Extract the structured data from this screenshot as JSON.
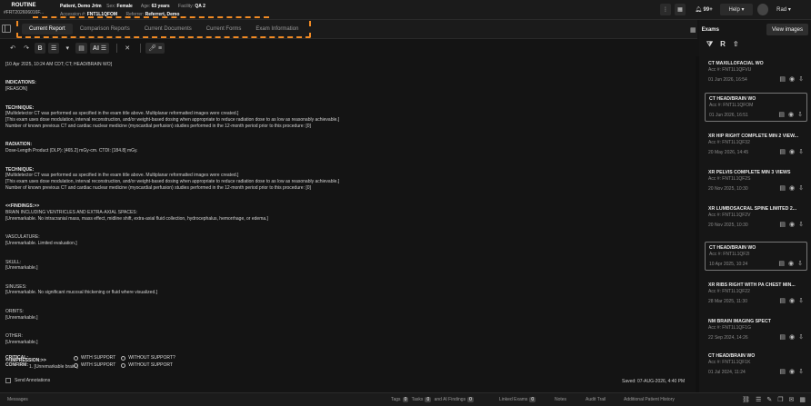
{
  "header": {
    "priority": "ROUTINE",
    "accession_id": "#FRT202606016F...",
    "patient_label": "Patient, Demo Jrtm",
    "sex_label": "Sex:",
    "sex": "Female",
    "age_label": "Age:",
    "age": "63 years",
    "facility_label": "Facility:",
    "facility": "QA 2",
    "accession_label": "Accession #:",
    "accession": "FNT1L1QFOM",
    "referrer_label": "Referrer:",
    "referrer": "Referrert, Demo",
    "notifications": "99+",
    "help": "Help",
    "user": "Rad"
  },
  "tabs": [
    {
      "label": "Current Report"
    },
    {
      "label": "Comparison Reports"
    },
    {
      "label": "Current Documents"
    },
    {
      "label": "Current Forms"
    },
    {
      "label": "Exam Information"
    }
  ],
  "toolbar": {
    "ai_label": "AI"
  },
  "report": {
    "line1": "[10 Apr 2025, 10:24 AM CDT; CT; HEAD/BRAIN WO]",
    "indications_h": "INDICATIONS:",
    "indications": "[REASON]",
    "technique_h": "TECHNIQUE:",
    "technique1": "[Multidetector CT was performed as specified in the exam title above. Multiplanar reformatted images were created.]",
    "technique2": "[This exam uses dose modulation, interval reconstruction, and/or weight-based dosing when appropriate to reduce radiation dose to as low as reasonably achievable.]",
    "technique3": "Number of known previous CT and cardiac nuclear medicine (myocardial perfusion) studies performed in the 12-month period prior to this procedure: [0]",
    "radiation_h": "RADIATION:",
    "radiation": "Dose-Length Product (DLP): [465.2] mGy-cm. CTDI: [184.8] mGy.",
    "technique_h2": "TECHNIQUE:",
    "technique4": "[Multidetector CT was performed as specified in the exam title above. Multiplanar reformatted images were created.]",
    "technique5": "[This exam uses dose modulation, interval reconstruction, and/or weight-based dosing when appropriate to reduce radiation dose to as low as reasonably achievable.]",
    "technique6": "Number of known previous CT and cardiac nuclear medicine (myocardial perfusion) studies performed in the 12-month period prior to this procedure: [0]",
    "findings_h": "<<FINDINGS:>>",
    "brain_h": "BRAIN INCLUDING VENTRICLES AND EXTRA-AXIAL SPACES:",
    "brain": "[Unremarkable. No intracranial mass, mass effect, midline shift, extra-axial fluid collection, hydrocephalus, hemorrhage, or edema.]",
    "vasc_h": "VASCULATURE:",
    "vasc": "[Unremarkable. Limited evaluation.]",
    "skull_h": "SKULL:",
    "skull": "[Unremarkable.]",
    "sinuses_h": "SINUSES:",
    "sinuses": "[Unremarkable. No significant mucosal thickening or fluid where visualized.]",
    "orbits_h": "ORBITS:",
    "orbits": "[Unremarkable.]",
    "other_h": "OTHER:",
    "other": "[Unremarkable.]",
    "impression_h": "<<IMPRESSION:>>",
    "impression": "1. [Unremarkable brain.]"
  },
  "fields": {
    "critical": "CRITICAL:",
    "confirm": "CONFIRM:",
    "with_support": "WITH SUPPORT",
    "without_support": "WITHOUT SUPPORT?",
    "without_support2": "WITHOUT SUPPORT"
  },
  "send_annotations": "Send Annotations",
  "saved": "Saved: 07-AUG-2026, 4:40 PM",
  "status": {
    "messages": "Messages",
    "tags": "Tags",
    "tags_n": "0",
    "tasks": "Tasks",
    "tasks_n": "0",
    "ai": "and AI Findings",
    "ai_n": "0",
    "linked": "Linked Exams",
    "linked_n": "0",
    "notes": "Notes",
    "audit": "Audit Trail",
    "history": "Additional Patient History"
  },
  "exams": {
    "title": "Exams",
    "view_images": "View images",
    "items": [
      {
        "title": "CT MAXILLOFACIAL WO",
        "acc": "Acc #: FNT1L1QFVU",
        "date": "01 Jun 2026, 16:54"
      },
      {
        "title": "CT HEAD/BRAIN WO",
        "acc": "Acc #: FNT1L1QFOM",
        "date": "01 Jun 2026, 16:51"
      },
      {
        "title": "XR HIP RIGHT COMPLETE MIN 2 VIEW...",
        "acc": "Acc #: FNT1L1QF32",
        "date": "20 May 2026, 14:45"
      },
      {
        "title": "XR PELVIS COMPLETE MIN 3 VIEWS",
        "acc": "Acc #: FNT1L1QF2S",
        "date": "20 Nov 2025, 10:30"
      },
      {
        "title": "XR LUMBOSACRAL SPINE LIMITED 2...",
        "acc": "Acc #: FNT1L1QF2V",
        "date": "20 Nov 2025, 10:30"
      },
      {
        "title": "CT HEAD/BRAIN WO",
        "acc": "Acc #: FNT1L1QF2I",
        "date": "10 Apr 2025, 10:24"
      },
      {
        "title": "XR RIBS RIGHT WITH PA CHEST MIN...",
        "acc": "Acc #: FNT1L1QF22",
        "date": "28 Mar 2025, 11:30"
      },
      {
        "title": "NM BRAIN IMAGING SPECT",
        "acc": "Acc #: FNT1L1QF1G",
        "date": "22 Sep 2024, 14:26"
      },
      {
        "title": "CT HEAD/BRAIN WO",
        "acc": "Acc #: FNT1L1QF1K",
        "date": "01 Jul 2024, 11:24"
      }
    ]
  }
}
